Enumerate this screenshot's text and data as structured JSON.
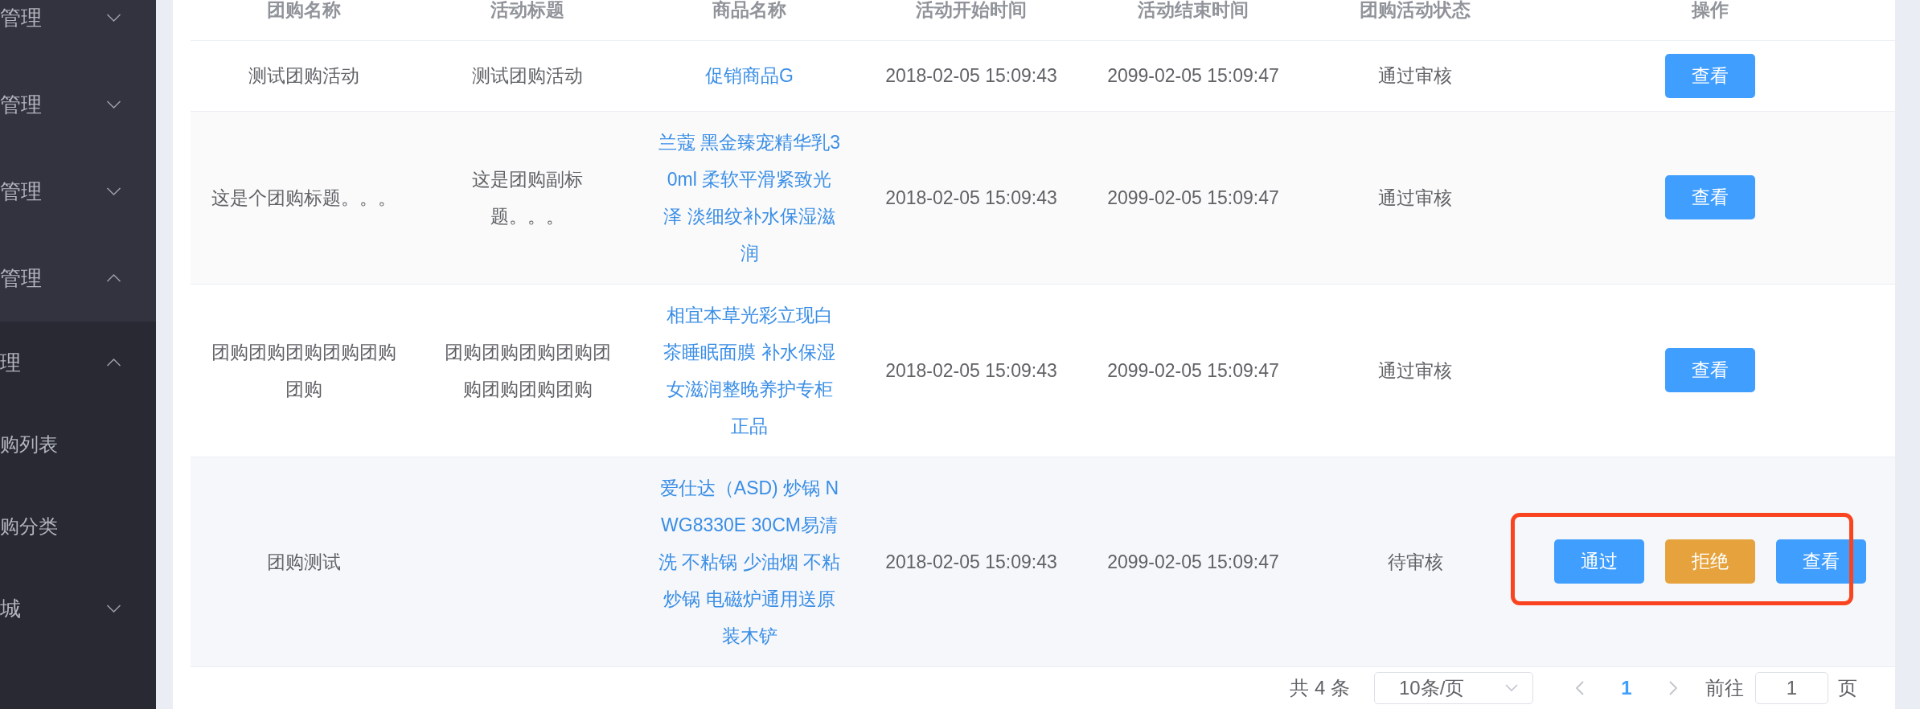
{
  "sidebar": {
    "items": [
      {
        "label": "管理",
        "expanded": false
      },
      {
        "label": "管理",
        "expanded": false
      },
      {
        "label": "管理",
        "expanded": false
      },
      {
        "label": "管理",
        "expanded": true,
        "children": [
          {
            "label": "理",
            "expanded": true,
            "children": [
              {
                "label": "购列表"
              },
              {
                "label": "购分类"
              }
            ]
          },
          {
            "label": "城",
            "expanded": false
          }
        ]
      }
    ]
  },
  "table": {
    "columns": [
      "团购名称",
      "活动标题",
      "商品名称",
      "活动开始时间",
      "活动结束时间",
      "团购活动状态",
      "操作"
    ],
    "rows": [
      {
        "group_name": "测试团购活动",
        "activity_title": "测试团购活动",
        "product_name": "促销商品G",
        "start_time": "2018-02-05 15:09:43",
        "end_time": "2099-02-05 15:09:47",
        "status": "通过审核",
        "actions": [
          {
            "label": "查看",
            "kind": "primary"
          }
        ],
        "hovered": false,
        "highlighted": false
      },
      {
        "group_name": "这是个团购标题。。。",
        "activity_title": "这是团购副标题。。。",
        "product_name": "兰蔻 黑金臻宠精华乳30ml 柔软平滑紧致光泽 淡细纹补水保湿滋润",
        "start_time": "2018-02-05 15:09:43",
        "end_time": "2099-02-05 15:09:47",
        "status": "通过审核",
        "actions": [
          {
            "label": "查看",
            "kind": "primary"
          }
        ],
        "hovered": false,
        "highlighted": false
      },
      {
        "group_name": "团购团购团购团购团购团购",
        "activity_title": "团购团购团购团购团购团购团购团购",
        "product_name": "相宜本草光彩立现白茶睡眠面膜 补水保湿女滋润整晚养护专柜正品",
        "start_time": "2018-02-05 15:09:43",
        "end_time": "2099-02-05 15:09:47",
        "status": "通过审核",
        "actions": [
          {
            "label": "查看",
            "kind": "primary"
          }
        ],
        "hovered": false,
        "highlighted": false
      },
      {
        "group_name": "团购测试",
        "product_name": "爱仕达（ASD) 炒锅 NWG8330E 30CM易清洗 不粘锅 少油烟 不粘炒锅 电磁炉通用送原装木铲",
        "start_time": "2018-02-05 15:09:43",
        "end_time": "2099-02-05 15:09:47",
        "status": "待审核",
        "actions": [
          {
            "label": "通过",
            "kind": "primary"
          },
          {
            "label": "拒绝",
            "kind": "warning"
          },
          {
            "label": "查看",
            "kind": "primary"
          }
        ],
        "hovered": true,
        "highlighted": true
      }
    ]
  },
  "pagination": {
    "total": "共 4 条",
    "page_size": "10条/页",
    "prev_disabled": true,
    "pages": [
      {
        "label": "1",
        "selected": true
      }
    ],
    "next_disabled": true,
    "goto_label": "前往",
    "goto_value": "1",
    "goto_suffix": "页"
  }
}
